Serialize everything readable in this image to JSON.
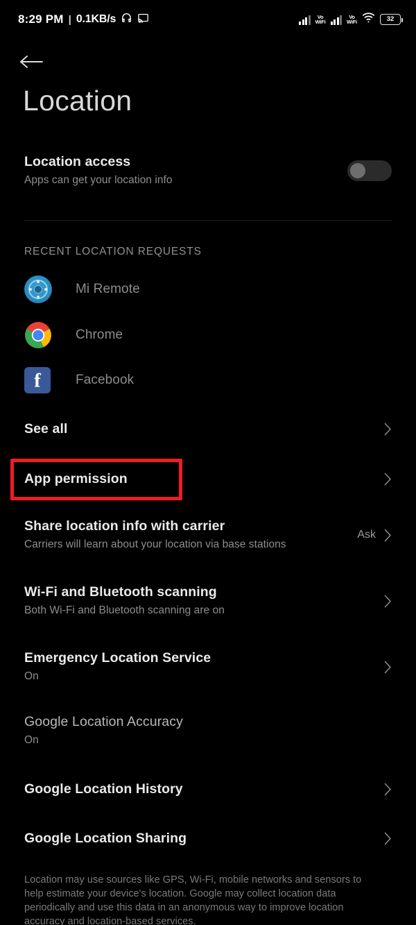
{
  "statusbar": {
    "time": "8:29 PM",
    "separator": "|",
    "network_speed": "0.1KB/s",
    "headphone_icon": "headphone-icon",
    "cast_icon": "cast-icon",
    "signal_1_icon": "signal-bars-icon",
    "volte_1": "Vo",
    "volte_1_sub": "WiFi",
    "signal_2_icon": "signal-bars-icon",
    "volte_2": "Vo",
    "volte_2_sub": "WiFi",
    "wifi_icon": "wifi-icon",
    "battery_level": "32"
  },
  "header": {
    "back_icon": "back-arrow-icon",
    "title": "Location"
  },
  "location_access": {
    "title": "Location access",
    "subtitle": "Apps can get your location info",
    "toggle_state": "off"
  },
  "recent_section": {
    "header": "RECENT LOCATION REQUESTS",
    "apps": [
      {
        "name": "Mi Remote",
        "icon": "mi-remote-icon"
      },
      {
        "name": "Chrome",
        "icon": "chrome-icon"
      },
      {
        "name": "Facebook",
        "icon": "facebook-icon"
      }
    ],
    "see_all": "See all"
  },
  "settings_rows": [
    {
      "title": "App permission",
      "subtitle": "",
      "value": "",
      "chevron": true,
      "highlighted": true
    },
    {
      "title": "Share location info with carrier",
      "subtitle": "Carriers will learn about your location via base stations",
      "value": "Ask",
      "chevron": true,
      "highlighted": false
    },
    {
      "title": "Wi-Fi and Bluetooth scanning",
      "subtitle": "Both Wi-Fi and Bluetooth scanning are on",
      "value": "",
      "chevron": true,
      "highlighted": false
    },
    {
      "title": "Emergency Location Service",
      "subtitle": "On",
      "value": "",
      "chevron": true,
      "highlighted": false
    },
    {
      "title": "Google Location Accuracy",
      "subtitle": "On",
      "value": "",
      "chevron": false,
      "highlighted": false
    },
    {
      "title": "Google Location History",
      "subtitle": "",
      "value": "",
      "chevron": true,
      "highlighted": false
    },
    {
      "title": "Google Location Sharing",
      "subtitle": "",
      "value": "",
      "chevron": true,
      "highlighted": false
    }
  ],
  "footer": {
    "text": "Location may use sources like GPS, Wi-Fi, mobile networks and sensors to help estimate your device's location. Google may collect location data periodically and use this data in an anonymous way to improve location accuracy and location-based services."
  },
  "colors": {
    "background": "#000000",
    "highlight": "#ed1c24",
    "title_text": "#d8d8d8",
    "primary_text": "#eaeaea",
    "secondary_text": "#8e8e8e"
  }
}
